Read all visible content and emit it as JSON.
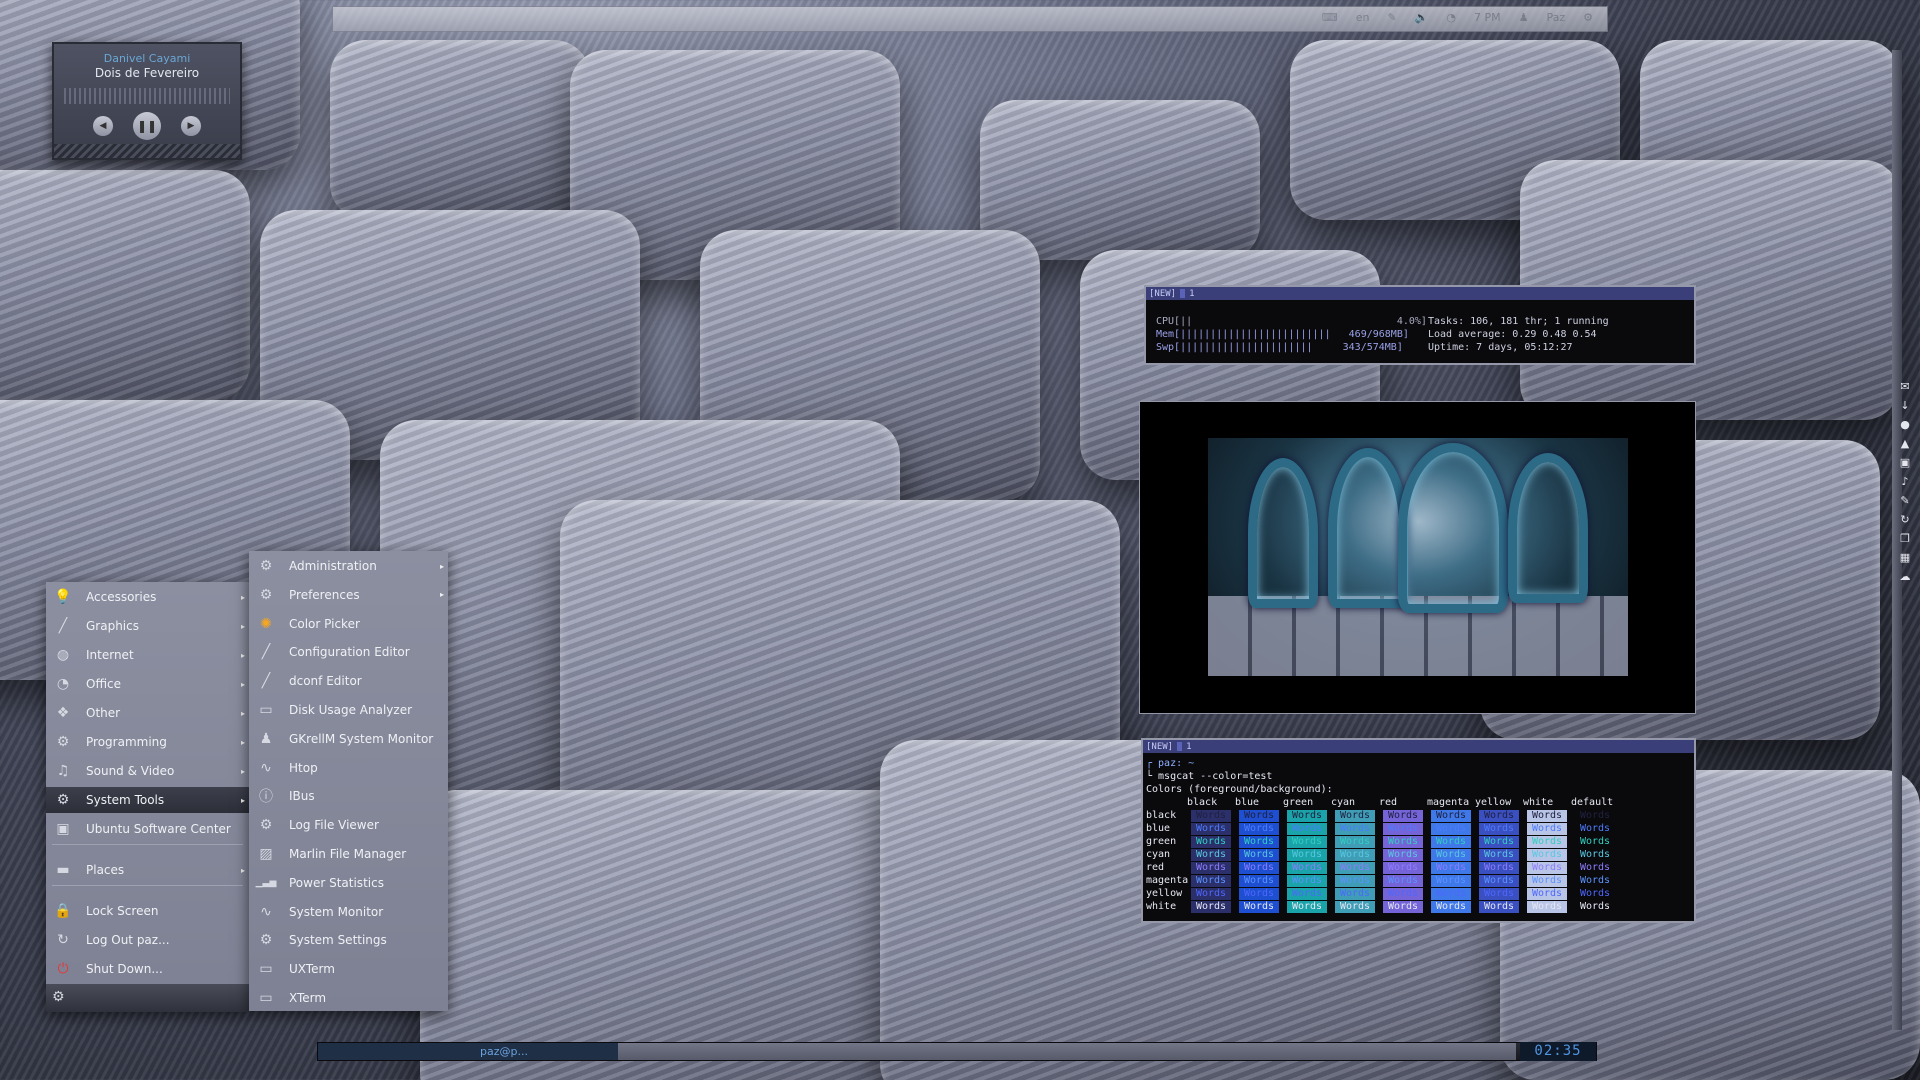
{
  "topbar": {
    "keyboard": "en",
    "volume_text": "",
    "network_text": "7 PM",
    "user": "Paz"
  },
  "media_player": {
    "artist": "Danivel Cayami",
    "song": "Dois de Fevereiro",
    "prev_icon": "◀",
    "pause_icon": "❚❚",
    "next_icon": "▶"
  },
  "main_menu": {
    "items": [
      {
        "label": "Accessories",
        "icon": "bulb-icon",
        "glyph": "💡",
        "arrow": "▸"
      },
      {
        "label": "Graphics",
        "icon": "brush-icon",
        "glyph": "╱",
        "arrow": "▸"
      },
      {
        "label": "Internet",
        "icon": "globe-icon",
        "glyph": "◍",
        "arrow": "▸"
      },
      {
        "label": "Office",
        "icon": "office-icon",
        "glyph": "◔",
        "arrow": "▸"
      },
      {
        "label": "Other",
        "icon": "other-icon",
        "glyph": "❖",
        "arrow": "▸"
      },
      {
        "label": "Programming",
        "icon": "gears-icon",
        "glyph": "⚙",
        "arrow": "▸"
      },
      {
        "label": "Sound & Video",
        "icon": "music-icon",
        "glyph": "♫",
        "arrow": "▸"
      },
      {
        "label": "System Tools",
        "icon": "system-tools-icon",
        "glyph": "⚙",
        "arrow": "▸"
      },
      {
        "label": "Ubuntu Software Center",
        "icon": "bag-icon",
        "glyph": "▣",
        "arrow": ""
      },
      {
        "label": "Places",
        "icon": "folder-icon",
        "glyph": "▬",
        "arrow": "▸"
      },
      {
        "label": "Lock Screen",
        "icon": "lock-icon",
        "glyph": "🔒",
        "arrow": ""
      },
      {
        "label": "Log Out paz...",
        "icon": "logout-icon",
        "glyph": "↻",
        "arrow": ""
      },
      {
        "label": "Shut Down...",
        "icon": "power-icon",
        "glyph": "⏻",
        "arrow": ""
      }
    ],
    "settings_glyph": "⚙"
  },
  "submenu": {
    "items": [
      {
        "label": "Administration",
        "icon": "admin-icon",
        "glyph": "⚙",
        "arrow": "▸"
      },
      {
        "label": "Preferences",
        "icon": "preferences-icon",
        "glyph": "⚙",
        "arrow": "▸"
      },
      {
        "label": "Color Picker",
        "icon": "color-wheel-icon",
        "glyph": "✺",
        "arrow": ""
      },
      {
        "label": "Configuration Editor",
        "icon": "wrench-icon",
        "glyph": "╱",
        "arrow": ""
      },
      {
        "label": "dconf Editor",
        "icon": "wrench-icon",
        "glyph": "╱",
        "arrow": ""
      },
      {
        "label": "Disk Usage Analyzer",
        "icon": "disk-icon",
        "glyph": "▭",
        "arrow": ""
      },
      {
        "label": "GKrellM System Monitor",
        "icon": "monitor-person-icon",
        "glyph": "♟",
        "arrow": ""
      },
      {
        "label": "Htop",
        "icon": "pulse-icon",
        "glyph": "∿",
        "arrow": ""
      },
      {
        "label": "IBus",
        "icon": "info-icon",
        "glyph": "ⓘ",
        "arrow": ""
      },
      {
        "label": "Log File Viewer",
        "icon": "log-gears-icon",
        "glyph": "⚙",
        "arrow": ""
      },
      {
        "label": "Marlin File Manager",
        "icon": "file-manager-icon",
        "glyph": "▨",
        "arrow": ""
      },
      {
        "label": "Power Statistics",
        "icon": "bar-chart-icon",
        "glyph": "▁▃▅",
        "arrow": ""
      },
      {
        "label": "System Monitor",
        "icon": "pulse-icon",
        "glyph": "∿",
        "arrow": ""
      },
      {
        "label": "System Settings",
        "icon": "settings-icon",
        "glyph": "⚙",
        "arrow": ""
      },
      {
        "label": "UXTerm",
        "icon": "terminal-icon",
        "glyph": "▭",
        "arrow": ""
      },
      {
        "label": "XTerm",
        "icon": "terminal-icon",
        "glyph": "▭",
        "arrow": ""
      }
    ]
  },
  "htop_terminal": {
    "tab_label": "[NEW]",
    "tab_number": "1",
    "cpu_line": "CPU[||                                  4.0%]",
    "mem_line": "Mem[|||||||||||||||||||||||||   469/968MB]",
    "swp_line": "Swp[||||||||||||||||||||||     343/574MB]",
    "tasks_line": "Tasks: 106, 181 thr; 1 running",
    "load_line": "Load average: 0.29 0.48 0.54",
    "uptime_line": "Uptime: 7 days, 05:12:27"
  },
  "color_terminal": {
    "tab_label": "[NEW]",
    "tab_number": "1",
    "prompt": "┌ paz: ~",
    "command": "└ msgcat --color=test",
    "title": "Colors (foreground/background):",
    "headers": [
      "black",
      "blue",
      "green",
      "cyan",
      "red",
      "magenta",
      "yellow",
      "white",
      "default"
    ],
    "rows": [
      "black",
      "blue",
      "green",
      "cyan",
      "red",
      "magenta",
      "yellow",
      "white"
    ],
    "cell_text": "Words",
    "palette": {
      "black": "#2b2f6a",
      "blue": "#1d4fd0",
      "green": "#1aa3a8",
      "cyan": "#3f9db6",
      "red": "#7564d8",
      "magenta": "#3f78e8",
      "yellow": "#3a4fc0",
      "white": "#b9c5e6",
      "default": "#0a0a0d"
    },
    "fg_palette": {
      "black": "#202040",
      "blue": "#4c7bff",
      "green": "#2fd0c0",
      "cyan": "#58c8e0",
      "red": "#8e7cff",
      "magenta": "#5a93ff",
      "yellow": "#4d67ff",
      "white": "#e4e8f5"
    }
  },
  "bottom_panel": {
    "task_label": "paz@p...",
    "clock": "02:35"
  },
  "right_sidebar": {
    "icons": [
      {
        "name": "mail-icon",
        "glyph": "✉"
      },
      {
        "name": "download-icon",
        "glyph": "↓"
      },
      {
        "name": "record-icon",
        "glyph": "●"
      },
      {
        "name": "triangle-icon",
        "glyph": "▲"
      },
      {
        "name": "flag-icon",
        "glyph": "▣"
      },
      {
        "name": "music-note-icon",
        "glyph": "♪"
      },
      {
        "name": "pen-icon",
        "glyph": "✎"
      },
      {
        "name": "refresh-icon",
        "glyph": "↻"
      },
      {
        "name": "copy-icon",
        "glyph": "❐"
      },
      {
        "name": "grid-icon",
        "glyph": "▦"
      },
      {
        "name": "cloud-icon",
        "glyph": "☁"
      }
    ]
  }
}
